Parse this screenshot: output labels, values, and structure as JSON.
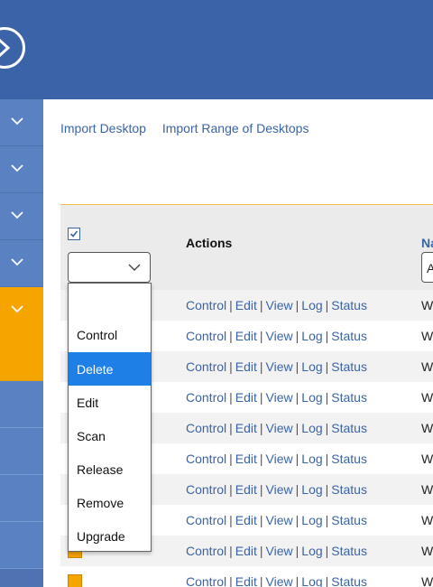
{
  "nav": {
    "import_desktop": "Import Desktop",
    "import_range": "Import Range of Desktops"
  },
  "table": {
    "header_actions": "Actions",
    "header_name": "Na",
    "name_filter_value": "A",
    "rows": [
      {
        "control": "Control",
        "edit": "Edit",
        "view": "View",
        "log": "Log",
        "status": "Status",
        "name": "W"
      },
      {
        "control": "Control",
        "edit": "Edit",
        "view": "View",
        "log": "Log",
        "status": "Status",
        "name": "W"
      },
      {
        "control": "Control",
        "edit": "Edit",
        "view": "View",
        "log": "Log",
        "status": "Status",
        "name": "W"
      },
      {
        "control": "Control",
        "edit": "Edit",
        "view": "View",
        "log": "Log",
        "status": "Status",
        "name": "W"
      },
      {
        "control": "Control",
        "edit": "Edit",
        "view": "View",
        "log": "Log",
        "status": "Status",
        "name": "W"
      },
      {
        "control": "Control",
        "edit": "Edit",
        "view": "View",
        "log": "Log",
        "status": "Status",
        "name": "W"
      },
      {
        "control": "Control",
        "edit": "Edit",
        "view": "View",
        "log": "Log",
        "status": "Status",
        "name": "W"
      },
      {
        "control": "Control",
        "edit": "Edit",
        "view": "View",
        "log": "Log",
        "status": "Status",
        "name": "W"
      },
      {
        "control": "Control",
        "edit": "Edit",
        "view": "View",
        "log": "Log",
        "status": "Status",
        "name": "W"
      },
      {
        "control": "Control",
        "edit": "Edit",
        "view": "View",
        "log": "Log",
        "status": "Status",
        "name": "W"
      }
    ]
  },
  "bulk_action_menu": {
    "options": [
      "",
      "Control",
      "Delete",
      "Edit",
      "Scan",
      "Release",
      "Remove",
      "Upgrade"
    ],
    "highlighted": "Delete"
  },
  "icons": {
    "logo": "circle-arrow-icon",
    "sidebar_chevron": "chevron-down-icon",
    "header_checkbox": "checkbox-checked-icon",
    "select_chevron": "chevron-down-icon"
  },
  "colors": {
    "topbar": "#3b64a8",
    "sidebar": "#5a82c3",
    "active": "#f5a400",
    "link": "#3a64a8",
    "menu_highlight": "#1e7fe6"
  }
}
